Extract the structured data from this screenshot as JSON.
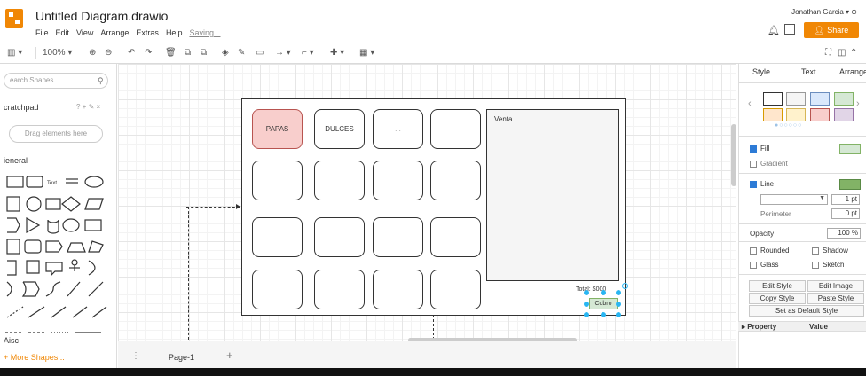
{
  "app": {
    "title": "Untitled Diagram.drawio",
    "menu": [
      "File",
      "Edit",
      "View",
      "Arrange",
      "Extras",
      "Help"
    ],
    "saving": "Saving...",
    "user": "Jonathan Garcia",
    "share_label": "Share"
  },
  "toolbar": {
    "zoom": "100%"
  },
  "left_panel": {
    "search_placeholder": "earch Shapes",
    "scratchpad": "cratchpad",
    "drag_here": "Drag elements here",
    "general": "ieneral",
    "misc": "Aisc",
    "more_shapes": "More Shapes..."
  },
  "canvas": {
    "cells": [
      "PAPAS",
      "DULCES",
      "...",
      "",
      "",
      "",
      "",
      "",
      "",
      "",
      "",
      "",
      "",
      "",
      "",
      ""
    ],
    "venta": "Venta",
    "total": "Total: $000",
    "cobro": "Cobro"
  },
  "pages": {
    "current": "Page-1"
  },
  "right_panel": {
    "tabs": [
      "Style",
      "Text",
      "Arrange"
    ],
    "fill": "Fill",
    "gradient": "Gradient",
    "line": "Line",
    "line_width": "1 pt",
    "perimeter": "Perimeter",
    "perimeter_value": "0 pt",
    "opacity": "Opacity",
    "opacity_value": "100 %",
    "rounded": "Rounded",
    "shadow": "Shadow",
    "glass": "Glass",
    "sketch": "Sketch",
    "edit_style": "Edit Style",
    "edit_image": "Edit Image",
    "copy_style": "Copy Style",
    "paste_style": "Paste Style",
    "set_default": "Set as Default Style",
    "property": "Property",
    "value": "Value"
  },
  "colors": {
    "accent": "#f08705",
    "papas_fill": "#f8cecc",
    "cobro_fill": "#d5e8d4",
    "selection": "#29b6f2"
  }
}
